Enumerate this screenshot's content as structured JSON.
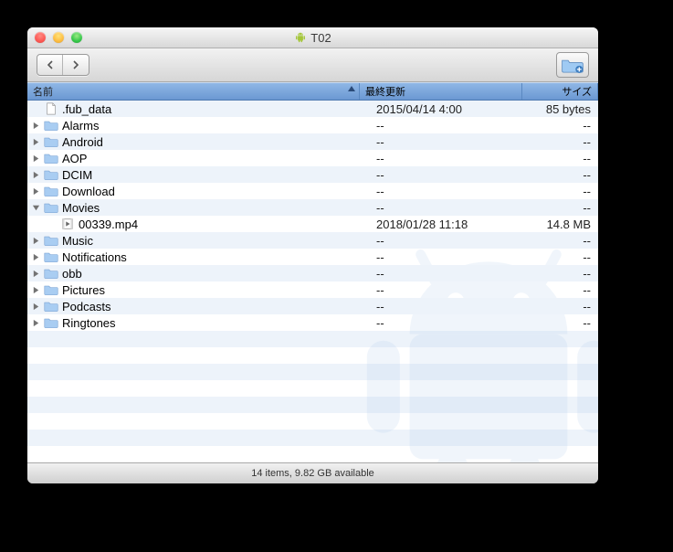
{
  "window": {
    "title": "T02"
  },
  "columns": {
    "name": "名前",
    "date": "最終更新",
    "size": "サイズ"
  },
  "rows": [
    {
      "indent": 0,
      "type": "file",
      "expanded": null,
      "name": ".fub_data",
      "date": "2015/04/14 4:00",
      "size": "85 bytes",
      "fileicon": "doc"
    },
    {
      "indent": 0,
      "type": "folder",
      "expanded": false,
      "name": "Alarms",
      "date": "--",
      "size": "--"
    },
    {
      "indent": 0,
      "type": "folder",
      "expanded": false,
      "name": "Android",
      "date": "--",
      "size": "--"
    },
    {
      "indent": 0,
      "type": "folder",
      "expanded": false,
      "name": "AOP",
      "date": "--",
      "size": "--"
    },
    {
      "indent": 0,
      "type": "folder",
      "expanded": false,
      "name": "DCIM",
      "date": "--",
      "size": "--"
    },
    {
      "indent": 0,
      "type": "folder",
      "expanded": false,
      "name": "Download",
      "date": "--",
      "size": "--"
    },
    {
      "indent": 0,
      "type": "folder",
      "expanded": true,
      "name": "Movies",
      "date": "--",
      "size": "--"
    },
    {
      "indent": 1,
      "type": "file",
      "expanded": null,
      "name": "00339.mp4",
      "date": "2018/01/28 11:18",
      "size": "14.8 MB",
      "fileicon": "movie"
    },
    {
      "indent": 0,
      "type": "folder",
      "expanded": false,
      "name": "Music",
      "date": "--",
      "size": "--"
    },
    {
      "indent": 0,
      "type": "folder",
      "expanded": false,
      "name": "Notifications",
      "date": "--",
      "size": "--"
    },
    {
      "indent": 0,
      "type": "folder",
      "expanded": false,
      "name": "obb",
      "date": "--",
      "size": "--"
    },
    {
      "indent": 0,
      "type": "folder",
      "expanded": false,
      "name": "Pictures",
      "date": "--",
      "size": "--"
    },
    {
      "indent": 0,
      "type": "folder",
      "expanded": false,
      "name": "Podcasts",
      "date": "--",
      "size": "--"
    },
    {
      "indent": 0,
      "type": "folder",
      "expanded": false,
      "name": "Ringtones",
      "date": "--",
      "size": "--"
    }
  ],
  "status": "14 items, 9.82 GB available"
}
